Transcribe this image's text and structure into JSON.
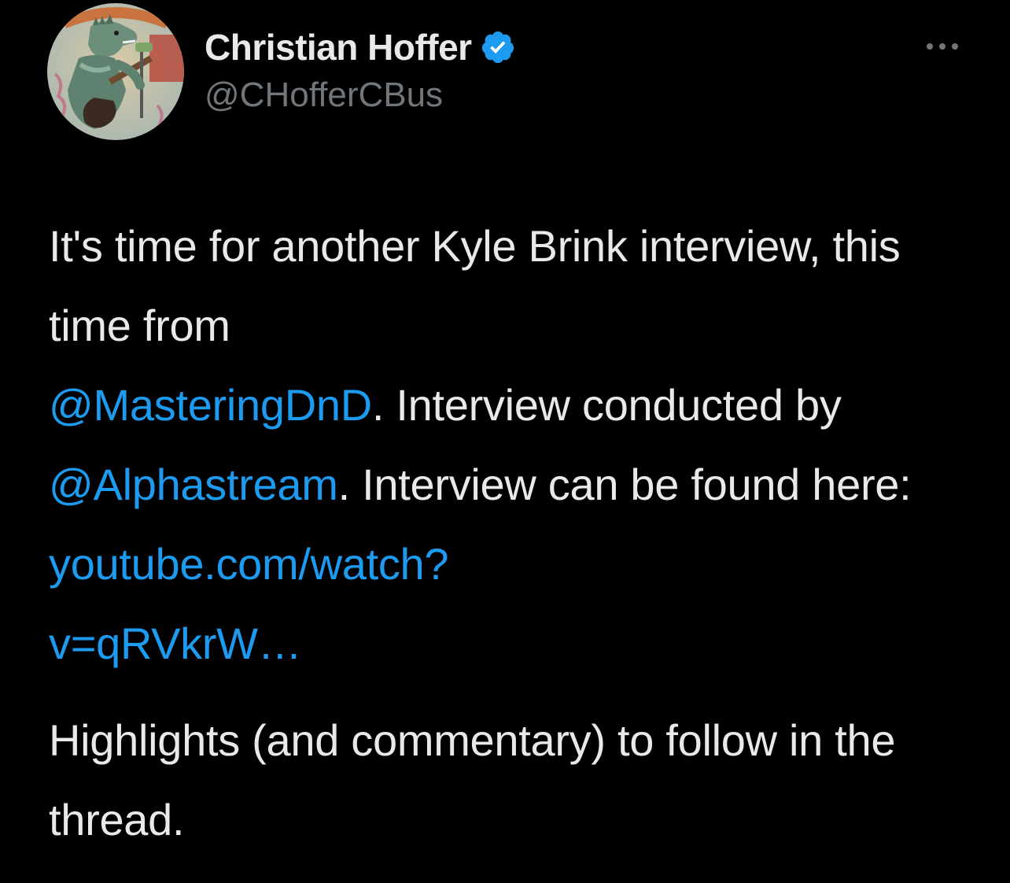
{
  "tweet": {
    "author": {
      "display_name": "Christian Hoffer",
      "handle": "@CHofferCBus",
      "verified": true,
      "avatar_description": "illustrated kaiju singing with guitar"
    },
    "more_icon": "more-horizontal-icon",
    "paragraphs": [
      {
        "segments": [
          {
            "text": "It's time for another Kyle Brink interview, this time from "
          },
          {
            "text": "@MasteringDnD",
            "link": true
          },
          {
            "text": ". Interview conducted by "
          },
          {
            "text": "@Alphastream",
            "link": true
          },
          {
            "text": ". Interview can be found here: "
          },
          {
            "text": "youtube.com/watch?",
            "link": true
          },
          {
            "text": "v=qRVkrW…",
            "link": true
          }
        ]
      },
      {
        "segments": [
          {
            "text": "Highlights (and commentary) to follow in the thread."
          }
        ]
      }
    ]
  },
  "colors": {
    "background": "#000000",
    "text": "#e7e9ea",
    "secondary_text": "#71767b",
    "link": "#1d9bf0",
    "verified_badge": "#1d9bf0"
  }
}
